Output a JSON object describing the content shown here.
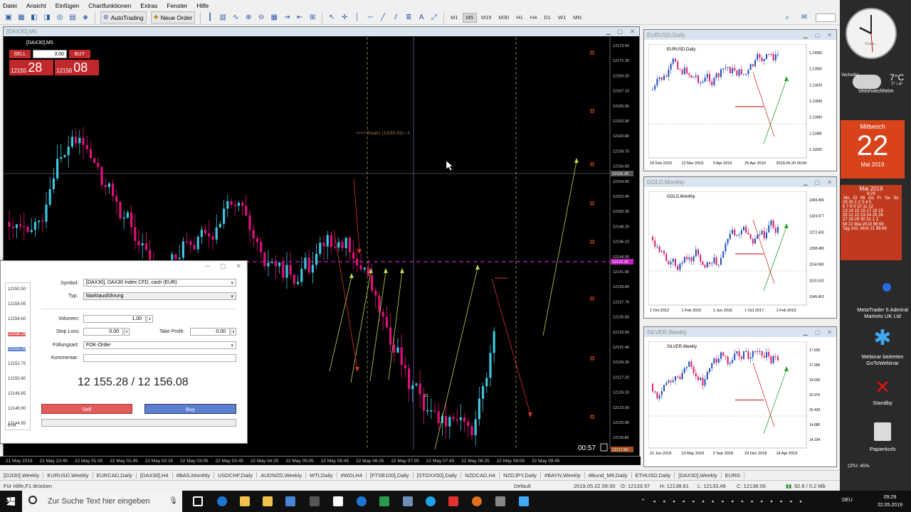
{
  "menu": [
    "Datei",
    "Ansicht",
    "Einfügen",
    "Chartfunktionen",
    "Extras",
    "Fenster",
    "Hilfe"
  ],
  "toolbar": {
    "autotrading_label": "AutoTrading",
    "new_order_label": "Neue Order",
    "timeframes": [
      "M1",
      "M5",
      "M15",
      "M30",
      "H1",
      "H4",
      "D1",
      "W1",
      "MN"
    ],
    "active_timeframe": "M5"
  },
  "main_chart": {
    "window_title": "[DAX30],M5",
    "symbol_label": "[DAX30],M5",
    "break_label": ">>>> Break1 (12160.43)<--5",
    "timer": "00:57",
    "z_label": "z1",
    "price_ticks": [
      "12173.50",
      "12171.30",
      "12169.20",
      "12167.10",
      "12165.00",
      "12162.90",
      "12160.80",
      "12158.70",
      "12156.60",
      "12154.50",
      "12152.40",
      "12150.30",
      "12148.20",
      "12146.10",
      "12144.00",
      "12141.90",
      "12139.80",
      "12137.70",
      "12135.60",
      "12133.50",
      "12131.40",
      "12129.30",
      "12127.20",
      "12125.10",
      "12123.00",
      "12120.90",
      "12118.80"
    ],
    "current_bid": "12155.28",
    "level_price": "12142.35",
    "last_price": "12117.66",
    "time_labels": [
      "21 May 2019",
      "21 May 22:45",
      "22 May 01:05",
      "22 May 01:45",
      "22 May 02:25",
      "22 May 03:05",
      "22 May 03:45",
      "22 May 04:25",
      "22 May 05:05",
      "22 May 05:45",
      "22 May 06:25",
      "22 May 07:05",
      "22 May 07:45",
      "22 May 08:25",
      "22 May 09:05",
      "22 May 09:45"
    ]
  },
  "oneclick": {
    "sell_label": "SELL",
    "buy_label": "BUY",
    "volume": "3.00",
    "sell_small": "12155",
    "sell_big": "28",
    "buy_small": "12156",
    "buy_big": "08"
  },
  "mini_charts": [
    {
      "title": "EURUSD,Daily",
      "symbol_label": "EURUSD,Daily",
      "ticks": [
        "1.14300",
        "1.13900",
        "1.13420",
        "1.12940",
        "1.12460",
        "1.11980",
        "1.11500"
      ],
      "dates": [
        "18 Feb 2019",
        "12 Mar 2019",
        "3 Apr 2019",
        "25 Apr 2019",
        "2019.05.20 00:00"
      ]
    },
    {
      "title": "GOLD,Monthly",
      "symbol_label": "GOLD,Monthly",
      "ticks": [
        "1369.456",
        "1324.977",
        "1272.430",
        "1208.480",
        "1154.960",
        "1101.510",
        "1045.452"
      ],
      "dates": [
        "1 Oct 2013",
        "1 Feb 2015",
        "1 Jun 2016",
        "1 Oct 2017",
        "1 Feb 2019"
      ]
    },
    {
      "title": "SILVER,Weekly",
      "symbol_label": "SILVER,Weekly",
      "ticks": [
        "17.630",
        "17.090",
        "16.530",
        "15.970",
        "15.430",
        "14.880",
        "14.334"
      ],
      "dates": [
        "21 Jun 2018",
        "13 May 2018",
        "2 Sep 2018",
        "23 Dec 2018",
        "14 Apr 2019"
      ]
    }
  ],
  "order_dialog": {
    "symbol_label": "Symbol:",
    "symbol_value": "[DAX30], DAX30 Index CFD, cash (EUR)",
    "type_label": "Typ:",
    "type_value": "Marktausführung",
    "volume_label": "Volumen:",
    "volume_value": "1.00",
    "stoploss_label": "Stop Loss:",
    "stoploss_value": "0.00",
    "takeprofit_label": "Take Profit:",
    "takeprofit_value": "0.00",
    "filling_label": "Füllungsart:",
    "filling_value": "FOK-Order",
    "comment_label": "Kommentar:",
    "comment_value": "",
    "price_display": "12 155.28 / 12 156.08",
    "sell_label": "Sell",
    "buy_label": "Buy",
    "ticks": [
      "12150.50",
      "12158.55",
      "12156.60",
      "12156.18",
      "12155.28",
      "12152.75",
      "12150.80",
      "12148.85",
      "12146.90",
      "12144.95"
    ],
    "bottom_tick": "9:04"
  },
  "tabs": [
    "[DJI30],Weekly",
    "EURUSD,Weekly",
    "EURCAD,Daily",
    "[DAX30],H4",
    "#BAS,Monthly",
    "USDCHF,Daily",
    "AUDNZD,Weekly",
    "WTI,Daily",
    "#WDI,H4",
    "[FTSE100],Daily",
    "[STOXX50],Daily",
    "NZDCAD,H4",
    "NZDJPY,Daily",
    "#BAYN,Weekly",
    "#Bund_M9,Daily",
    "ETHUSD,Daily",
    "[DAX30],Weekly",
    "EURG"
  ],
  "status": {
    "help": "Für Hilfe,F1 drücken",
    "profile": "Default",
    "datetime": "2019.05.22 09:30",
    "open": "O: 12133.97",
    "high": "H: 12138.61",
    "low": "L: 12133.48",
    "close": "C: 12138.06",
    "traffic": "92.8 / 0.2 Mb"
  },
  "desktop": {
    "clock_brand": "Costa...",
    "weather_temp": "7°C",
    "weather_range": "7° / 4°",
    "weather_city": "Vechelde",
    "weather_sub": "Veitshoechheim",
    "weekday": "Mittwoch",
    "day": "22",
    "month_year": "Mai 2019",
    "cal_header": "Mai 2019",
    "cal_time": "9:29",
    "cal_days": [
      "Mo",
      "Di",
      "Mi",
      "Do",
      "Fr",
      "Sa",
      "So"
    ],
    "cal_rows": [
      "29 30 1 2 3 4 5",
      "6 7 8 9 10 11 12",
      "13 14 15 16 17 18 19",
      "20 21 22 23 24 25 26",
      "27 28 29 30 31 1 2"
    ],
    "cal_footer1": "Mi 22 Mai 2019 99:99",
    "cal_footer2": "Tag 142, Wch 21 99:99",
    "cpu": "CPU: 45%",
    "icon_metatrader": "MetaTrader 5 Admiral Markets UK Ltd",
    "icon_gotowebinar": "Webinar beitreten GoToWebinar",
    "icon_standby": "Standby",
    "icon_bin": "Papierkorb"
  },
  "taskbar": {
    "search_placeholder": "Zur Suche Text hier eingeben",
    "lang": "DEU",
    "time": "09:29",
    "date": "22.05.2019"
  },
  "colors": {
    "bull": "#3fc6e0",
    "bear": "#e0107a",
    "arrow_up": "#b8d84a",
    "arrow_down": "#d83232",
    "level": "#c020c0",
    "accent": "#c0282b"
  }
}
